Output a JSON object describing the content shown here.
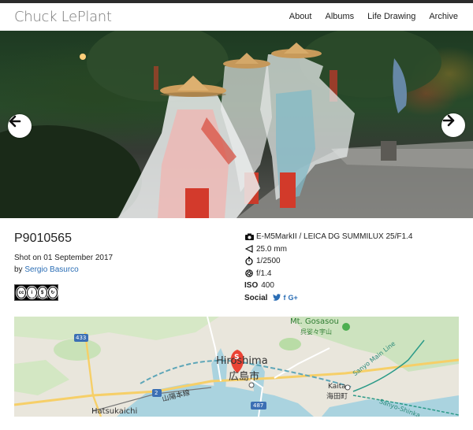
{
  "header": {
    "brand": "Chuck LePlant",
    "nav": [
      "About",
      "Albums",
      "Life Drawing",
      "Archive"
    ]
  },
  "photo": {
    "title": "P9010565",
    "shot_on": "Shot on 01 September 2017",
    "by_prefix": "by",
    "author": "Sergio Basurco",
    "license_badge_text": "BY NC SA"
  },
  "exif": {
    "camera": "E-M5MarkII / LEICA DG SUMMILUX 25/F1.4",
    "focal": "25.0 mm",
    "shutter": "1/2500",
    "aperture": "f/1.4",
    "iso_label": "ISO",
    "iso_value": "400",
    "social_label": "Social",
    "social_icons": [
      "twitter-icon",
      "facebook-icon",
      "google-plus-icon"
    ]
  },
  "map": {
    "labels": {
      "gosasou": "Mt. Gosasou",
      "gosasou_jp": "呉娑々宇山",
      "hiroshima": "Hiroshima",
      "hiroshima_jp": "広島市",
      "kaita": "Kaita",
      "kaita_jp": "海田町",
      "sanyo_main": "Sanyo Main Line",
      "sanyo_shinkansen": "Sanyo-Shinka",
      "hatsukaichi": "Hatsukaichi",
      "sanyo_hon": "山陽本線",
      "route_433": "433",
      "route_2": "2",
      "route_487": "487",
      "marker_letter": "S"
    }
  },
  "colors": {
    "link": "#2a6db5",
    "marker": "#ea4335",
    "topbar": "#2b2b2b"
  }
}
